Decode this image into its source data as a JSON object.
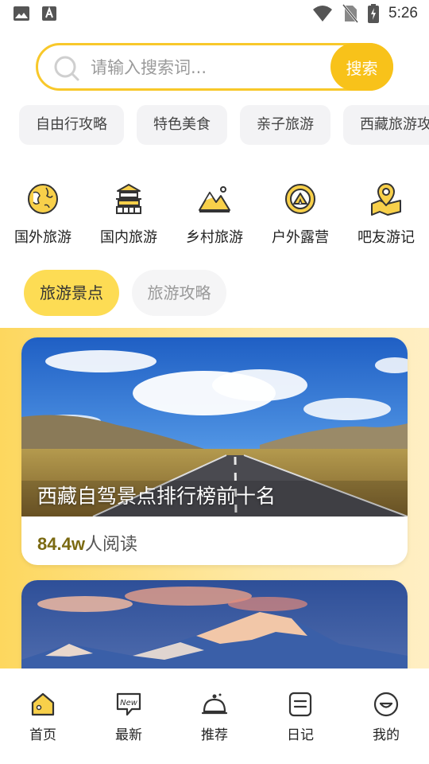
{
  "status_bar": {
    "time": "5:26",
    "icons": [
      "image-icon",
      "keyboard-a-icon",
      "wifi-icon",
      "no-sim-icon",
      "battery-charging-icon"
    ]
  },
  "search": {
    "placeholder": "请输入搜索词...",
    "button_label": "搜索"
  },
  "chips": [
    {
      "label": "自由行攻略"
    },
    {
      "label": "特色美食"
    },
    {
      "label": "亲子旅游"
    },
    {
      "label": "西藏旅游攻略"
    }
  ],
  "categories": [
    {
      "label": "国外旅游",
      "icon": "globe-icon"
    },
    {
      "label": "国内旅游",
      "icon": "temple-icon"
    },
    {
      "label": "乡村旅游",
      "icon": "mountain-icon"
    },
    {
      "label": "户外露营",
      "icon": "tent-icon"
    },
    {
      "label": "吧友游记",
      "icon": "map-pin-icon"
    }
  ],
  "tabs": {
    "active": "旅游景点",
    "inactive": "旅游攻略"
  },
  "cards": [
    {
      "title": "西藏自驾景点排行榜前十名",
      "reads_count": "84.4w",
      "reads_suffix": "人阅读"
    }
  ],
  "bottom_nav": [
    {
      "label": "首页",
      "icon": "home-icon"
    },
    {
      "label": "最新",
      "icon": "new-badge-icon"
    },
    {
      "label": "推荐",
      "icon": "cloche-icon"
    },
    {
      "label": "日记",
      "icon": "notebook-icon"
    },
    {
      "label": "我的",
      "icon": "smiley-icon"
    }
  ],
  "colors": {
    "accent": "#f8c21a",
    "tab_active": "#fddc54",
    "reads_count": "#7b6a12"
  }
}
